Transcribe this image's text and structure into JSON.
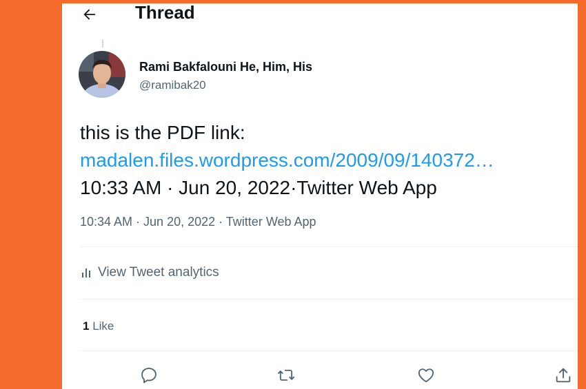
{
  "header": {
    "title": "Thread"
  },
  "tweet": {
    "author": {
      "display_name": "Rami Bakfalouni He, Him, His",
      "handle": "@ramibak20"
    },
    "text_line1": "this is the PDF link:",
    "link_text": "madalen.files.wordpress.com/2009/09/140372…",
    "text_line3": "10:33 AM · Jun 20, 2022·Twitter Web App",
    "meta": "10:34 AM · Jun 20, 2022 · Twitter Web App"
  },
  "analytics": {
    "label": "View Tweet analytics"
  },
  "likes": {
    "count": "1",
    "label": "Like"
  },
  "colors": {
    "page_background": "#f46b2c",
    "link": "#1d9bf0",
    "secondary_text": "#536471",
    "primary_text": "#0f1419"
  },
  "icons": [
    "back-arrow-icon",
    "analytics-bar-icon",
    "reply-icon",
    "retweet-icon",
    "like-heart-icon",
    "share-icon"
  ]
}
